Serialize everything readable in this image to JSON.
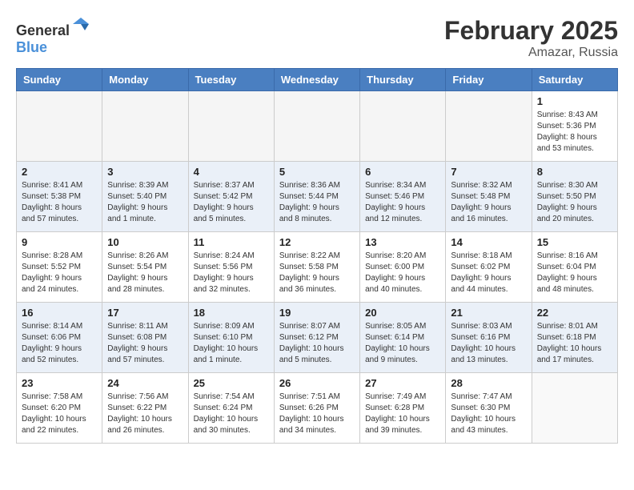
{
  "header": {
    "logo_general": "General",
    "logo_blue": "Blue",
    "month_year": "February 2025",
    "location": "Amazar, Russia"
  },
  "days_of_week": [
    "Sunday",
    "Monday",
    "Tuesday",
    "Wednesday",
    "Thursday",
    "Friday",
    "Saturday"
  ],
  "weeks": [
    {
      "row_class": "week-row-1",
      "days": [
        {
          "num": "",
          "info": "",
          "empty": true
        },
        {
          "num": "",
          "info": "",
          "empty": true
        },
        {
          "num": "",
          "info": "",
          "empty": true
        },
        {
          "num": "",
          "info": "",
          "empty": true
        },
        {
          "num": "",
          "info": "",
          "empty": true
        },
        {
          "num": "",
          "info": "",
          "empty": true
        },
        {
          "num": "1",
          "info": "Sunrise: 8:43 AM\nSunset: 5:36 PM\nDaylight: 8 hours\nand 53 minutes.",
          "empty": false
        }
      ]
    },
    {
      "row_class": "week-row-2",
      "days": [
        {
          "num": "2",
          "info": "Sunrise: 8:41 AM\nSunset: 5:38 PM\nDaylight: 8 hours\nand 57 minutes.",
          "empty": false
        },
        {
          "num": "3",
          "info": "Sunrise: 8:39 AM\nSunset: 5:40 PM\nDaylight: 9 hours\nand 1 minute.",
          "empty": false
        },
        {
          "num": "4",
          "info": "Sunrise: 8:37 AM\nSunset: 5:42 PM\nDaylight: 9 hours\nand 5 minutes.",
          "empty": false
        },
        {
          "num": "5",
          "info": "Sunrise: 8:36 AM\nSunset: 5:44 PM\nDaylight: 9 hours\nand 8 minutes.",
          "empty": false
        },
        {
          "num": "6",
          "info": "Sunrise: 8:34 AM\nSunset: 5:46 PM\nDaylight: 9 hours\nand 12 minutes.",
          "empty": false
        },
        {
          "num": "7",
          "info": "Sunrise: 8:32 AM\nSunset: 5:48 PM\nDaylight: 9 hours\nand 16 minutes.",
          "empty": false
        },
        {
          "num": "8",
          "info": "Sunrise: 8:30 AM\nSunset: 5:50 PM\nDaylight: 9 hours\nand 20 minutes.",
          "empty": false
        }
      ]
    },
    {
      "row_class": "week-row-3",
      "days": [
        {
          "num": "9",
          "info": "Sunrise: 8:28 AM\nSunset: 5:52 PM\nDaylight: 9 hours\nand 24 minutes.",
          "empty": false
        },
        {
          "num": "10",
          "info": "Sunrise: 8:26 AM\nSunset: 5:54 PM\nDaylight: 9 hours\nand 28 minutes.",
          "empty": false
        },
        {
          "num": "11",
          "info": "Sunrise: 8:24 AM\nSunset: 5:56 PM\nDaylight: 9 hours\nand 32 minutes.",
          "empty": false
        },
        {
          "num": "12",
          "info": "Sunrise: 8:22 AM\nSunset: 5:58 PM\nDaylight: 9 hours\nand 36 minutes.",
          "empty": false
        },
        {
          "num": "13",
          "info": "Sunrise: 8:20 AM\nSunset: 6:00 PM\nDaylight: 9 hours\nand 40 minutes.",
          "empty": false
        },
        {
          "num": "14",
          "info": "Sunrise: 8:18 AM\nSunset: 6:02 PM\nDaylight: 9 hours\nand 44 minutes.",
          "empty": false
        },
        {
          "num": "15",
          "info": "Sunrise: 8:16 AM\nSunset: 6:04 PM\nDaylight: 9 hours\nand 48 minutes.",
          "empty": false
        }
      ]
    },
    {
      "row_class": "week-row-4",
      "days": [
        {
          "num": "16",
          "info": "Sunrise: 8:14 AM\nSunset: 6:06 PM\nDaylight: 9 hours\nand 52 minutes.",
          "empty": false
        },
        {
          "num": "17",
          "info": "Sunrise: 8:11 AM\nSunset: 6:08 PM\nDaylight: 9 hours\nand 57 minutes.",
          "empty": false
        },
        {
          "num": "18",
          "info": "Sunrise: 8:09 AM\nSunset: 6:10 PM\nDaylight: 10 hours\nand 1 minute.",
          "empty": false
        },
        {
          "num": "19",
          "info": "Sunrise: 8:07 AM\nSunset: 6:12 PM\nDaylight: 10 hours\nand 5 minutes.",
          "empty": false
        },
        {
          "num": "20",
          "info": "Sunrise: 8:05 AM\nSunset: 6:14 PM\nDaylight: 10 hours\nand 9 minutes.",
          "empty": false
        },
        {
          "num": "21",
          "info": "Sunrise: 8:03 AM\nSunset: 6:16 PM\nDaylight: 10 hours\nand 13 minutes.",
          "empty": false
        },
        {
          "num": "22",
          "info": "Sunrise: 8:01 AM\nSunset: 6:18 PM\nDaylight: 10 hours\nand 17 minutes.",
          "empty": false
        }
      ]
    },
    {
      "row_class": "week-row-5",
      "days": [
        {
          "num": "23",
          "info": "Sunrise: 7:58 AM\nSunset: 6:20 PM\nDaylight: 10 hours\nand 22 minutes.",
          "empty": false
        },
        {
          "num": "24",
          "info": "Sunrise: 7:56 AM\nSunset: 6:22 PM\nDaylight: 10 hours\nand 26 minutes.",
          "empty": false
        },
        {
          "num": "25",
          "info": "Sunrise: 7:54 AM\nSunset: 6:24 PM\nDaylight: 10 hours\nand 30 minutes.",
          "empty": false
        },
        {
          "num": "26",
          "info": "Sunrise: 7:51 AM\nSunset: 6:26 PM\nDaylight: 10 hours\nand 34 minutes.",
          "empty": false
        },
        {
          "num": "27",
          "info": "Sunrise: 7:49 AM\nSunset: 6:28 PM\nDaylight: 10 hours\nand 39 minutes.",
          "empty": false
        },
        {
          "num": "28",
          "info": "Sunrise: 7:47 AM\nSunset: 6:30 PM\nDaylight: 10 hours\nand 43 minutes.",
          "empty": false
        },
        {
          "num": "",
          "info": "",
          "empty": true
        }
      ]
    }
  ]
}
